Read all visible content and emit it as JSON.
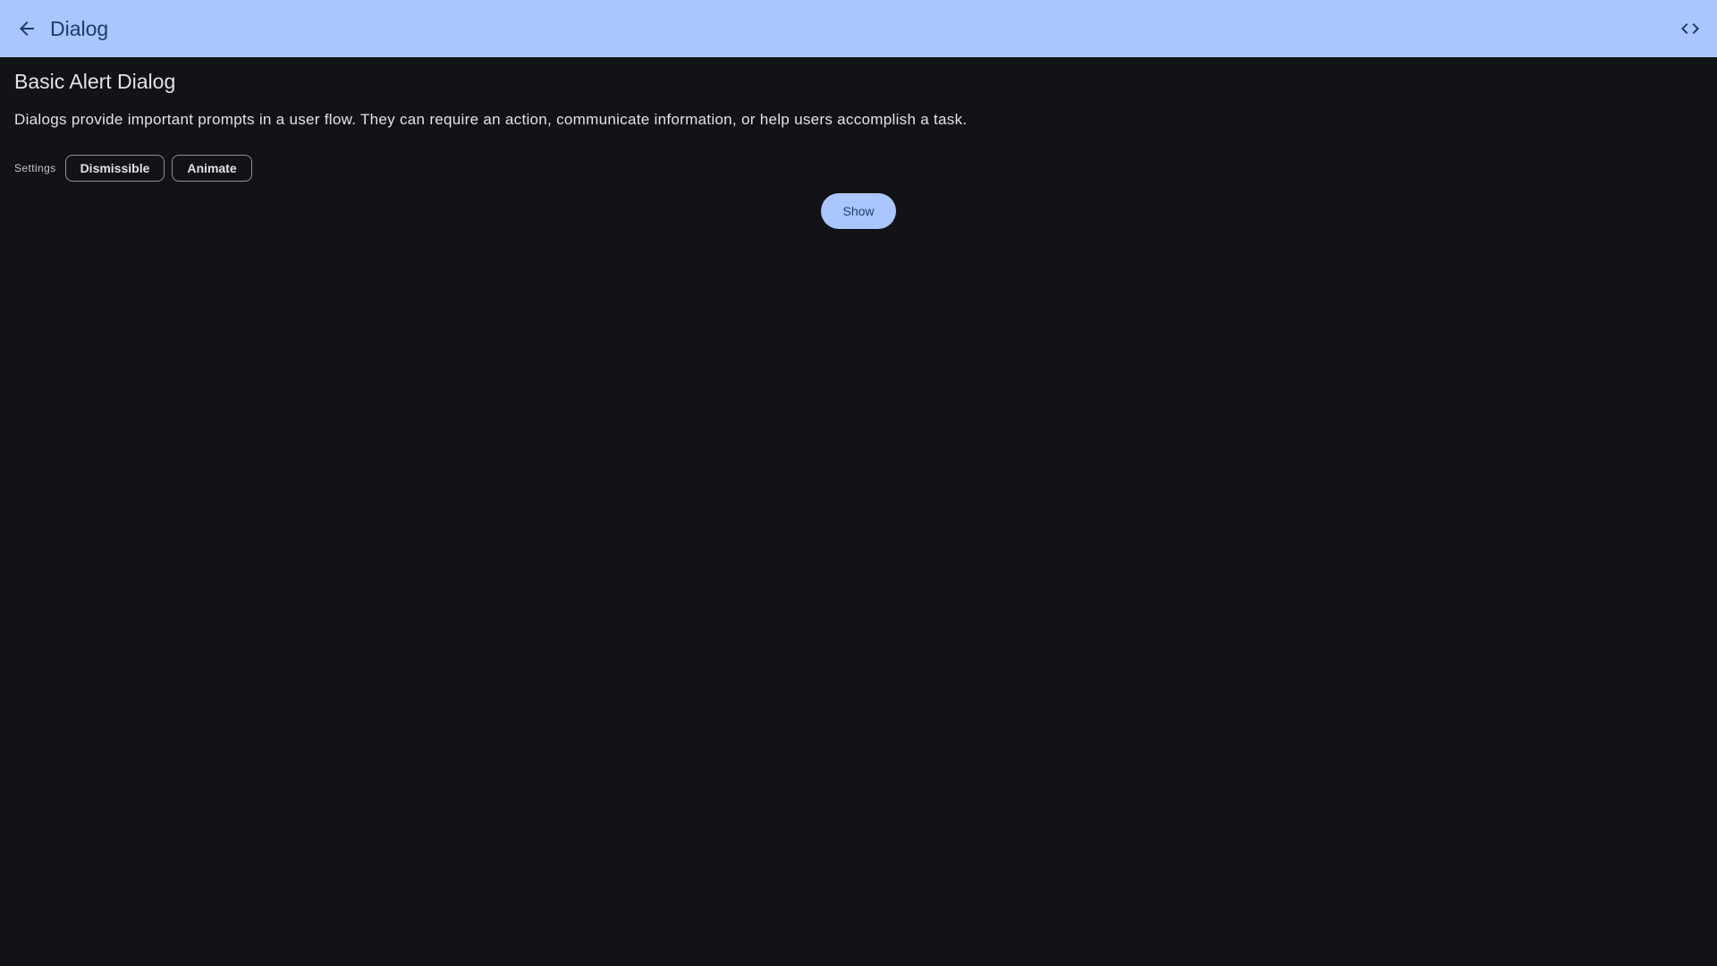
{
  "appbar": {
    "title": "Dialog",
    "back_icon": "arrow-left-icon",
    "code_icon": "code-icon"
  },
  "section": {
    "title": "Basic Alert Dialog",
    "description": "Dialogs provide important prompts in a user flow. They can require an action, communicate information, or help users accomplish a task."
  },
  "settings": {
    "label": "Settings",
    "chips": [
      {
        "label": "Dismissible"
      },
      {
        "label": "Animate"
      }
    ]
  },
  "actions": {
    "show_label": "Show"
  },
  "colors": {
    "primary": "#abc6ff",
    "on_primary": "#1f3a6e",
    "background": "#111316",
    "on_surface": "#e2e2e9",
    "outline": "#8e9099"
  }
}
